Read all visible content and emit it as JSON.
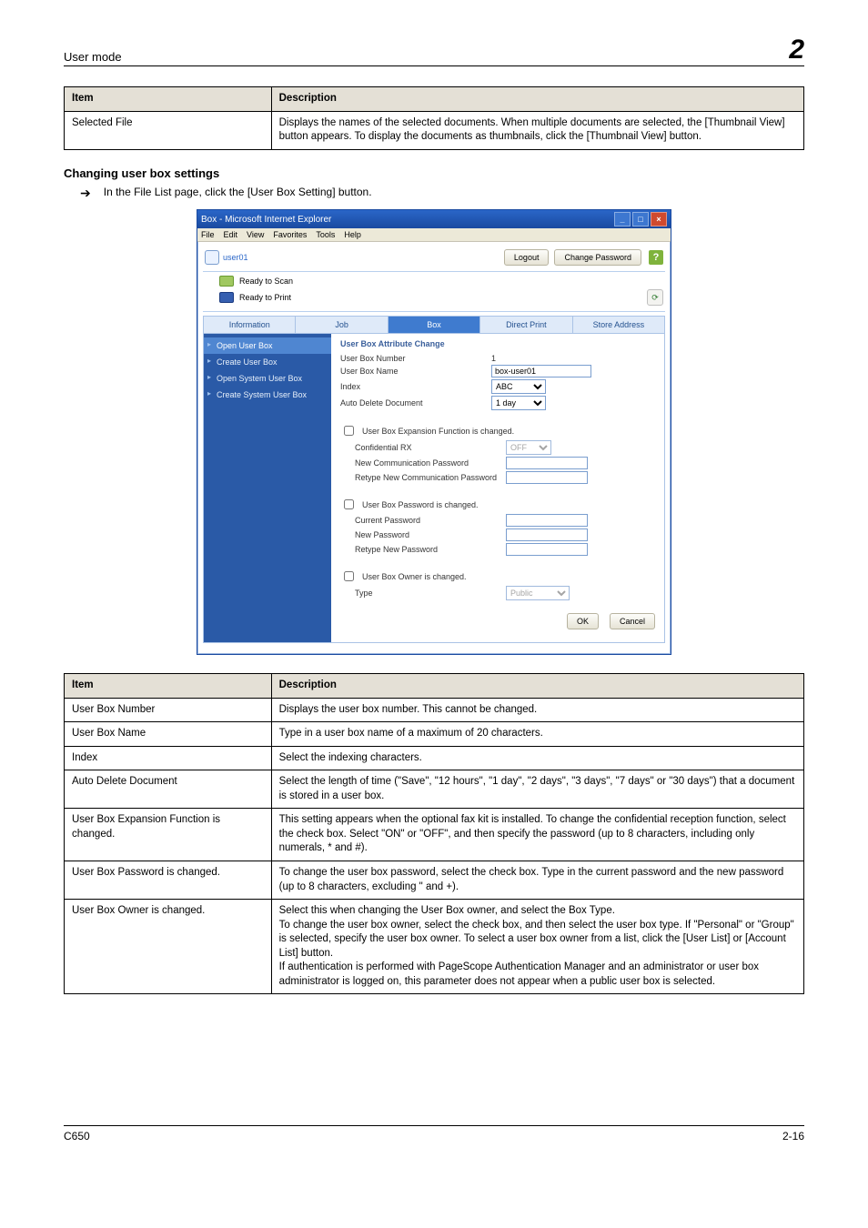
{
  "header": {
    "left": "User mode",
    "right": "2"
  },
  "table1": {
    "cols": [
      "Item",
      "Description"
    ],
    "rows": [
      {
        "item": "Selected File",
        "desc": "Displays the names of the selected documents. When multiple documents are selected, the [Thumbnail View] button appears. To display the documents as thumbnails, click the [Thumbnail View] button."
      }
    ]
  },
  "subheading": "Changing user box settings",
  "arrow_line": "In the File List page, click the [User Box Setting] button.",
  "shot": {
    "window_title": "Box - Microsoft Internet Explorer",
    "menu": [
      "File",
      "Edit",
      "View",
      "Favorites",
      "Tools",
      "Help"
    ],
    "user": "user01",
    "logout": "Logout",
    "change_pw": "Change Password",
    "status": {
      "scan": "Ready to Scan",
      "print": "Ready to Print"
    },
    "tabs": [
      "Information",
      "Job",
      "Box",
      "Direct Print",
      "Store Address"
    ],
    "active_tab": 2,
    "sidebar": [
      "Open User Box",
      "Create User Box",
      "Open System User Box",
      "Create System User Box"
    ],
    "sidebar_active": 0,
    "form": {
      "heading": "User Box Attribute Change",
      "box_number_lbl": "User Box Number",
      "box_number_val": "1",
      "box_name_lbl": "User Box Name",
      "box_name_val": "box-user01",
      "index_lbl": "Index",
      "index_val": "ABC",
      "autodel_lbl": "Auto Delete Document",
      "autodel_val": "1 day",
      "exp_chk_lbl": "User Box Expansion Function is changed.",
      "conf_rx_lbl": "Confidential RX",
      "conf_rx_val": "OFF",
      "new_comm_pw_lbl": "New Communication Password",
      "retype_comm_pw_lbl": "Retype New Communication Password",
      "pw_chk_lbl": "User Box Password is changed.",
      "cur_pw_lbl": "Current Password",
      "new_pw_lbl": "New Password",
      "retype_pw_lbl": "Retype New Password",
      "owner_chk_lbl": "User Box Owner is changed.",
      "type_lbl": "Type",
      "type_val": "Public",
      "ok": "OK",
      "cancel": "Cancel"
    }
  },
  "table2": {
    "cols": [
      "Item",
      "Description"
    ],
    "rows": [
      {
        "item": "User Box Number",
        "desc": "Displays the user box number. This cannot be changed."
      },
      {
        "item": "User Box Name",
        "desc": "Type in a user box name of a maximum of 20 characters."
      },
      {
        "item": "Index",
        "desc": "Select the indexing characters."
      },
      {
        "item": "Auto Delete Document",
        "desc": "Select the length of time (\"Save\", \"12 hours\", \"1 day\", \"2 days\", \"3 days\", \"7 days\" or \"30 days\") that a document is stored in a user box."
      },
      {
        "item": "User Box Expansion Function is changed.",
        "desc": "This setting appears when the optional fax kit is installed. To change the confidential reception function, select the check box. Select \"ON\" or \"OFF\", and then specify the password (up to 8 characters, including only numerals, * and #)."
      },
      {
        "item": "User Box Password is changed.",
        "desc": "To change the user box password, select the check box. Type in the current password and the new password (up to 8 characters, excluding \" and +)."
      },
      {
        "item": "User Box Owner is changed.",
        "desc": "Select this when changing the User Box owner, and select the Box Type.\nTo change the user box owner, select the check box, and then select the user box type. If \"Personal\" or \"Group\" is selected, specify the user box owner. To select a user box owner from a list, click the [User List] or [Account List] button.\nIf authentication is performed with PageScope Authentication Manager and an administrator or user box administrator is logged on, this parameter does not appear when a public user box is selected."
      }
    ]
  },
  "footer": {
    "left": "C650",
    "right": "2-16"
  }
}
